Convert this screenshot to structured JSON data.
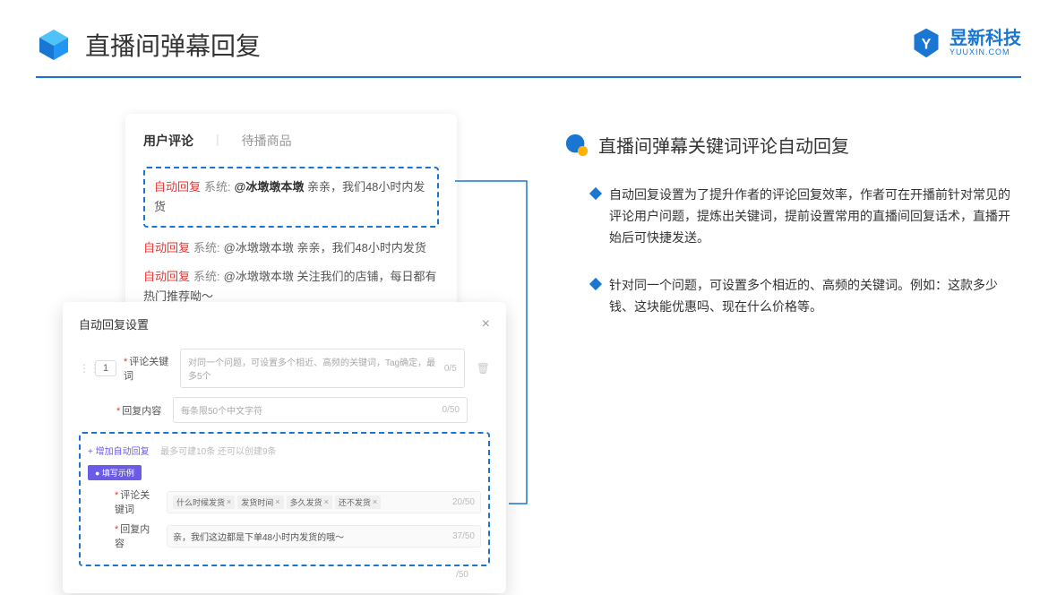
{
  "header": {
    "title": "直播间弹幕回复"
  },
  "logo": {
    "text": "昱新科技",
    "sub": "YUUXIN.COM"
  },
  "card1": {
    "tab1": "用户评论",
    "tab2": "待播商品",
    "auto_tag": "自动回复",
    "sys_tag": "系统:",
    "c1_user": "@冰墩墩本墩",
    "c1_text": " 亲亲，我们48小时内发货",
    "c2_user": "@冰墩墩本墩",
    "c2_text": " 亲亲，我们48小时内发货",
    "c3_user": "@冰墩墩本墩",
    "c3_text": " 关注我们的店铺，每日都有热门推荐呦～"
  },
  "card2": {
    "title": "自动回复设置",
    "num": "1",
    "label_keyword": "评论关键词",
    "label_content": "回复内容",
    "placeholder_kw": "对同一个问题，可设置多个相近、高频的关键词，Tag确定，最多5个",
    "counter_kw": "0/5",
    "placeholder_content": "每条限50个中文字符",
    "counter_content": "0/50",
    "add_link": "+ 增加自动回复",
    "add_hint": "最多可建10条 还可以创建9条",
    "example_badge": "● 填写示例",
    "ex_kw_label": "评论关键词",
    "tags": [
      "什么时候发货",
      "发货时间",
      "多久发货",
      "还不发货"
    ],
    "ex_kw_counter": "20/50",
    "ex_content_label": "回复内容",
    "ex_content": "亲，我们这边都是下单48小时内发货的哦～",
    "ex_content_counter": "37/50",
    "outer_counter": "/50"
  },
  "right": {
    "section_title": "直播间弹幕关键词评论自动回复",
    "bullet1": "自动回复设置为了提升作者的评论回复效率，作者可在开播前针对常见的评论用户问题，提炼出关键词，提前设置常用的直播间回复话术，直播开始后可快捷发送。",
    "bullet2": "针对同一个问题，可设置多个相近的、高频的关键词。例如：这款多少钱、这块能优惠吗、现在什么价格等。"
  }
}
